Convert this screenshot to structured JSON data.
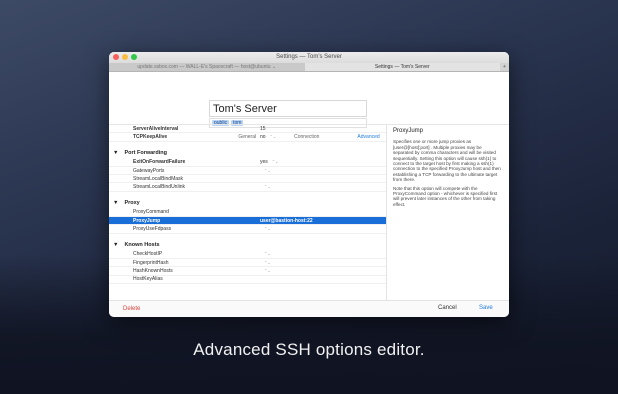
{
  "window": {
    "title": "Settings — Tom's Server"
  },
  "tabbar": {
    "tabs": [
      "update.ssbox.com — WALL-E's Spacecraft — host@ubuntu ⌄",
      "Settings — Tom's Server"
    ],
    "add": "+"
  },
  "server": {
    "name": "Tom's Server",
    "tags": [
      "public",
      "tom"
    ]
  },
  "sections": {
    "tabs": [
      "General",
      "Connection",
      "Advanced"
    ],
    "active": "Advanced"
  },
  "options": {
    "top": [
      {
        "k": "ServerAliveInterval",
        "v": "15"
      },
      {
        "k": "TCPKeepAlive",
        "v": "no"
      }
    ],
    "port_forwarding": {
      "label": "Port Forwarding",
      "rows": [
        {
          "k": "ExitOnForwardFailure",
          "v": "yes"
        },
        {
          "k": "GatewayPorts",
          "v": ""
        },
        {
          "k": "StreamLocalBindMask",
          "v": ""
        },
        {
          "k": "StreamLocalBindUnlink",
          "v": ""
        }
      ]
    },
    "proxy": {
      "label": "Proxy",
      "rows": [
        {
          "k": "ProxyCommand",
          "v": ""
        },
        {
          "k": "ProxyJump",
          "v": "user@bastion-host:22"
        },
        {
          "k": "ProxyUseFdpass",
          "v": ""
        }
      ]
    },
    "known_hosts": {
      "label": "Known Hosts",
      "rows": [
        {
          "k": "CheckHostIP",
          "v": ""
        },
        {
          "k": "FingerprintHash",
          "v": ""
        },
        {
          "k": "HashKnownHosts",
          "v": ""
        },
        {
          "k": "HostKeyAlias",
          "v": ""
        }
      ]
    }
  },
  "help": {
    "title": "ProxyJump",
    "p1": "Specifies one or more jump proxies as [user@]host[:port] . Multiple proxies may be separated by comma characters and will be visited sequentially. Setting this option will cause ssh(1) to connect to the target host by first making a ssh(1) connection to the specified ProxyJump host and then establishing a TCP forwarding to the ultimate target from there.",
    "p2": "Note that this option will compete with the ProxyCommand option - whichever is specified first will prevent later instances of the other from taking effect."
  },
  "footer": {
    "delete": "Delete",
    "cancel": "Cancel",
    "save": "Save"
  },
  "caption": "Advanced SSH options editor."
}
